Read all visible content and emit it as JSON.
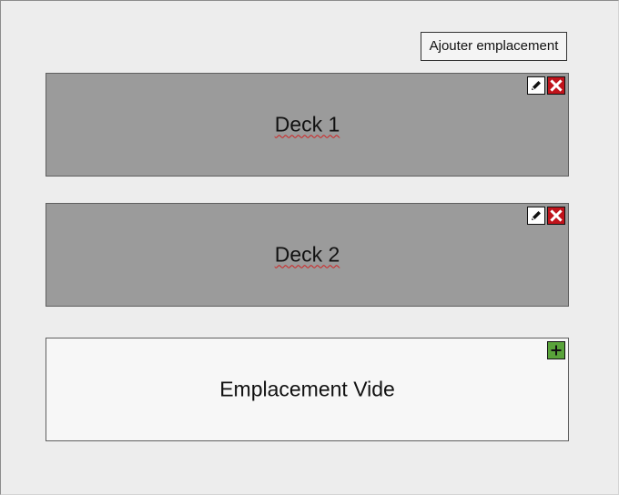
{
  "toolbar": {
    "add_slot_label": "Ajouter emplacement"
  },
  "slots": [
    {
      "label": "Deck 1",
      "state": "filled",
      "actions": [
        "edit",
        "delete"
      ]
    },
    {
      "label": "Deck 2",
      "state": "filled",
      "actions": [
        "edit",
        "delete"
      ]
    },
    {
      "label": "Emplacement Vide",
      "state": "empty",
      "actions": [
        "add"
      ]
    }
  ],
  "icons": {
    "edit": "pencil-icon",
    "delete": "close-icon",
    "add": "plus-icon"
  },
  "colors": {
    "background": "#ededed",
    "filled_slot": "#9b9b9b",
    "empty_slot": "#f7f7f7",
    "delete": "#c0131b",
    "add": "#59a33a"
  }
}
